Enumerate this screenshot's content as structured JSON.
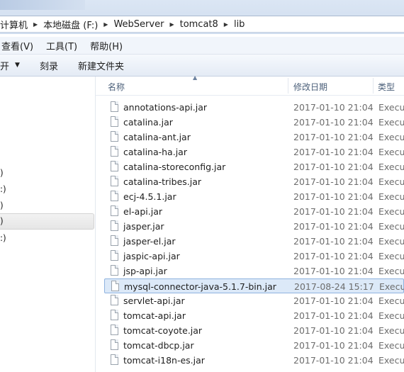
{
  "address": {
    "crumbs": [
      "计算机",
      "本地磁盘 (F:)",
      "WebServer",
      "tomcat8",
      "lib"
    ]
  },
  "menubar": [
    "查看(V)",
    "工具(T)",
    "帮助(H)"
  ],
  "toolbar": {
    "open_label": "开",
    "burn_label": "刻录",
    "new_folder_label": "新建文件夹"
  },
  "nav": {
    "items": [
      ")",
      ":)",
      ")",
      ")",
      ":)"
    ]
  },
  "list": {
    "headers": {
      "name": "名称",
      "date": "修改日期",
      "type": "类型"
    },
    "files": [
      {
        "name": "annotations-api.jar",
        "date": "2017-01-10 21:04",
        "type": "Execut"
      },
      {
        "name": "catalina.jar",
        "date": "2017-01-10 21:04",
        "type": "Execut"
      },
      {
        "name": "catalina-ant.jar",
        "date": "2017-01-10 21:04",
        "type": "Execut"
      },
      {
        "name": "catalina-ha.jar",
        "date": "2017-01-10 21:04",
        "type": "Execut"
      },
      {
        "name": "catalina-storeconfig.jar",
        "date": "2017-01-10 21:04",
        "type": "Execut"
      },
      {
        "name": "catalina-tribes.jar",
        "date": "2017-01-10 21:04",
        "type": "Execut"
      },
      {
        "name": "ecj-4.5.1.jar",
        "date": "2017-01-10 21:04",
        "type": "Execut"
      },
      {
        "name": "el-api.jar",
        "date": "2017-01-10 21:04",
        "type": "Execut"
      },
      {
        "name": "jasper.jar",
        "date": "2017-01-10 21:04",
        "type": "Execut"
      },
      {
        "name": "jasper-el.jar",
        "date": "2017-01-10 21:04",
        "type": "Execut"
      },
      {
        "name": "jaspic-api.jar",
        "date": "2017-01-10 21:04",
        "type": "Execut"
      },
      {
        "name": "jsp-api.jar",
        "date": "2017-01-10 21:04",
        "type": "Execut"
      },
      {
        "name": "mysql-connector-java-5.1.7-bin.jar",
        "date": "2017-08-24 15:17",
        "type": "Execut"
      },
      {
        "name": "servlet-api.jar",
        "date": "2017-01-10 21:04",
        "type": "Execut"
      },
      {
        "name": "tomcat-api.jar",
        "date": "2017-01-10 21:04",
        "type": "Execut"
      },
      {
        "name": "tomcat-coyote.jar",
        "date": "2017-01-10 21:04",
        "type": "Execut"
      },
      {
        "name": "tomcat-dbcp.jar",
        "date": "2017-01-10 21:04",
        "type": "Execut"
      },
      {
        "name": "tomcat-i18n-es.jar",
        "date": "2017-01-10 21:04",
        "type": "Execut"
      }
    ]
  }
}
